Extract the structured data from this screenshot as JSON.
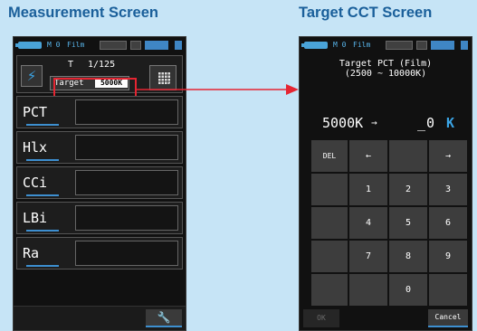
{
  "captions": {
    "measurement": "Measurement Screen",
    "target": "Target CCT Screen"
  },
  "statusbar": {
    "mode": "M 0",
    "film": "Film"
  },
  "measurement": {
    "shutter_label": "T",
    "shutter_value": "1/125",
    "target_label": "Target",
    "target_value": "5000K",
    "rows": [
      {
        "label": "PCT"
      },
      {
        "label": "Hlx"
      },
      {
        "label": "CCi"
      },
      {
        "label": "LBi"
      },
      {
        "label": "Ra"
      }
    ]
  },
  "target_screen": {
    "title_line1": "Target PCT (Film)",
    "title_line2": "(2500 ~ 10000K)",
    "current_value": "5000K",
    "arrow": "→",
    "new_value": "_0",
    "unit": "K",
    "keys": {
      "del": "DEL",
      "left": "←",
      "right": "→",
      "k1": "1",
      "k2": "2",
      "k3": "3",
      "k4": "4",
      "k5": "5",
      "k6": "6",
      "k7": "7",
      "k8": "8",
      "k9": "9",
      "k0": "0"
    },
    "ok": "OK",
    "cancel": "Cancel"
  },
  "colors": {
    "background": "#c6e4f6",
    "caption": "#1a5f9a",
    "accent": "#3ba5e6",
    "highlight": "#e52532"
  },
  "icons": {
    "flash": "lightning-icon",
    "menu": "grid-icon",
    "tools": "wrench-icon"
  }
}
